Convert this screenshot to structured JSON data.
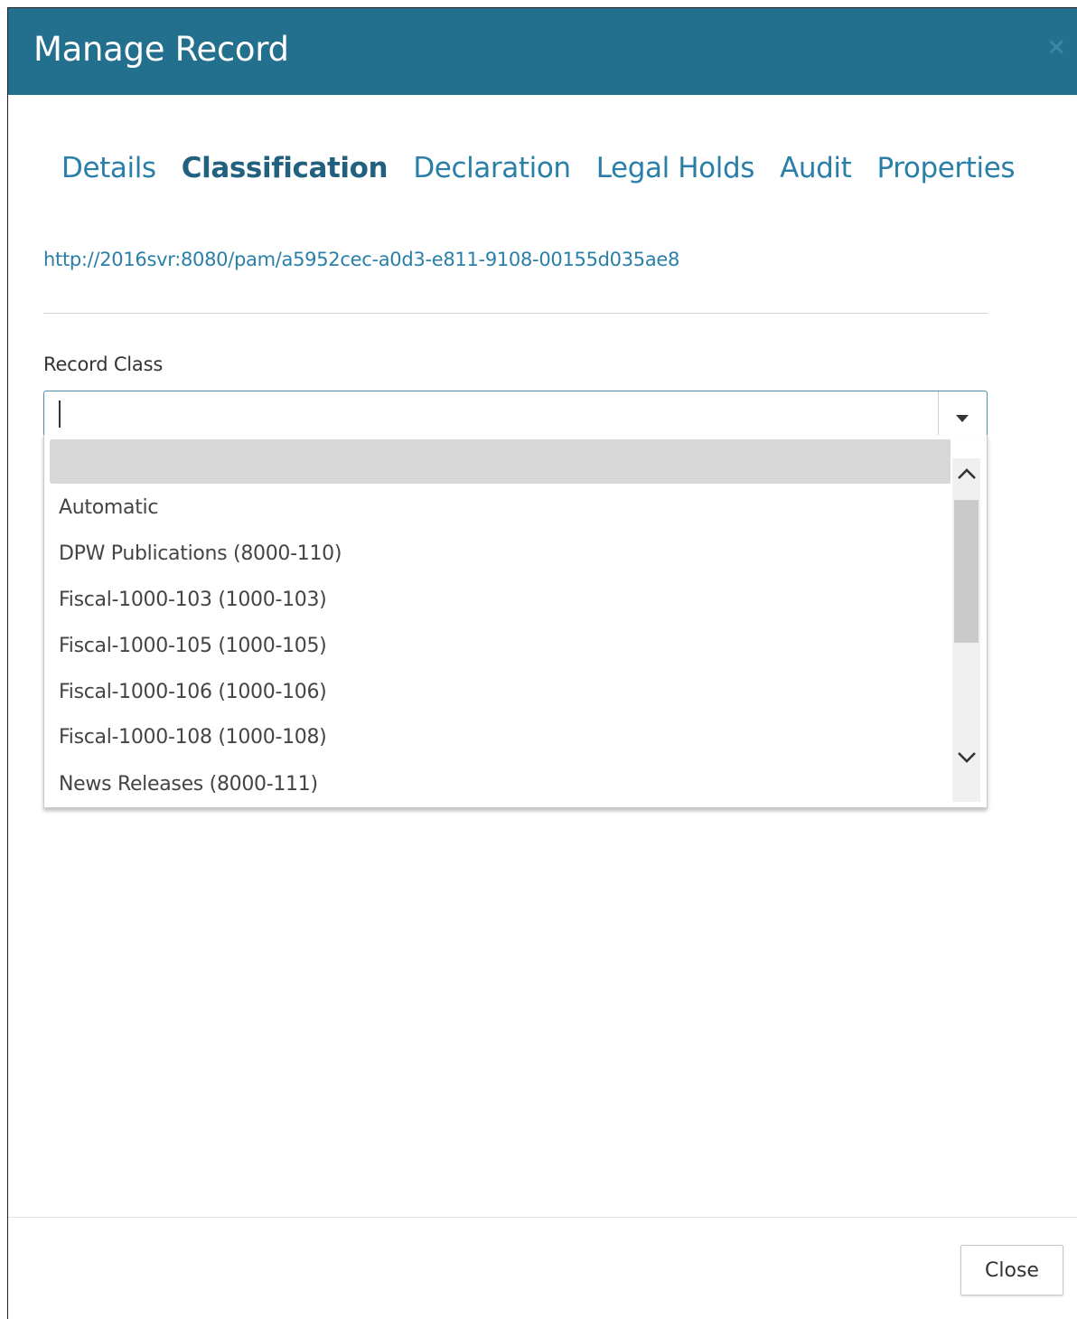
{
  "dialog": {
    "title": "Manage Record",
    "close_icon": "close-icon"
  },
  "tabs": [
    {
      "label": "Details",
      "active": false
    },
    {
      "label": "Classification",
      "active": true
    },
    {
      "label": "Declaration",
      "active": false
    },
    {
      "label": "Legal Holds",
      "active": false
    },
    {
      "label": "Audit",
      "active": false
    },
    {
      "label": "Properties",
      "active": false
    }
  ],
  "record_url": "http://2016svr:8080/pam/a5952cec-a0d3-e811-9108-00155d035ae8",
  "record_class": {
    "label": "Record Class",
    "value": "",
    "options": [
      "",
      "Automatic",
      "DPW Publications (8000-110)",
      "Fiscal-1000-103 (1000-103)",
      "Fiscal-1000-105 (1000-105)",
      "Fiscal-1000-106 (1000-106)",
      "Fiscal-1000-108 (1000-108)",
      "News Releases (8000-111)"
    ]
  },
  "footer": {
    "close_label": "Close"
  },
  "colors": {
    "header_bg": "#236f8e",
    "link": "#2a7fa8",
    "active_tab": "#21607e"
  }
}
